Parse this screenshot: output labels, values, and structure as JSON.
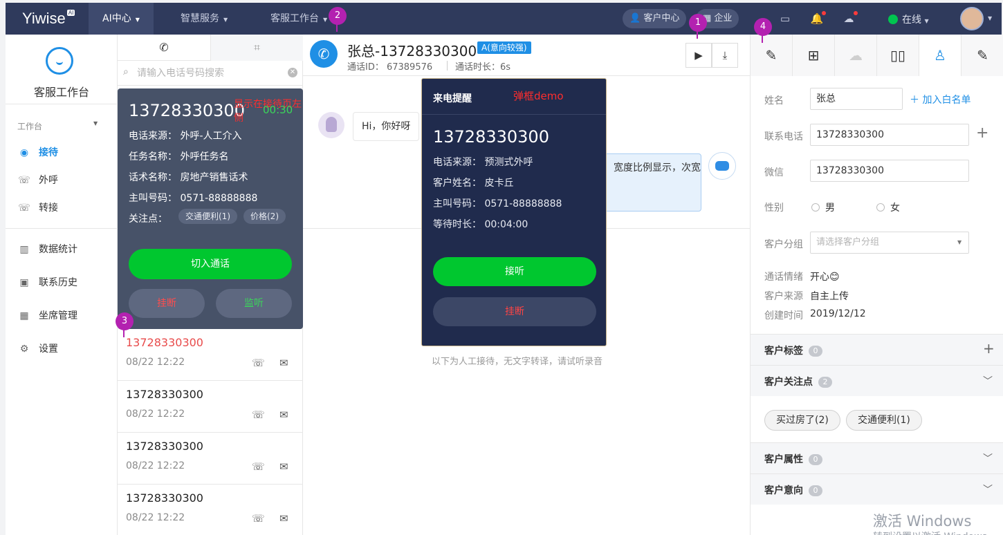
{
  "topbar": {
    "logo": "Yiwise",
    "logo_badge": "AI",
    "nav": [
      "AI中心",
      "智慧服务",
      "客服工作台"
    ],
    "customer_center": "客户中心",
    "enterprise": "企业",
    "status": "在线"
  },
  "sidebar": {
    "title": "客服工作台",
    "group_label": "工作台",
    "items": [
      {
        "label": "接待",
        "icon": "reception-icon"
      },
      {
        "label": "外呼",
        "icon": "outbound-call-icon"
      },
      {
        "label": "转接",
        "icon": "transfer-call-icon"
      },
      {
        "label": "数据统计",
        "icon": "bar-chart-icon"
      },
      {
        "label": "联系历史",
        "icon": "history-icon"
      },
      {
        "label": "坐席管理",
        "icon": "grid-icon"
      },
      {
        "label": "设置",
        "icon": "gear-icon"
      }
    ]
  },
  "list_panel": {
    "search_placeholder": "请输入电话号码搜索",
    "calls": [
      {
        "number": "13728330300",
        "time": "08/22  12:22",
        "missed": true
      },
      {
        "number": "13728330300",
        "time": "08/22  12:22",
        "missed": false
      },
      {
        "number": "13728330300",
        "time": "08/22  12:22",
        "missed": false
      },
      {
        "number": "13728330300",
        "time": "08/22  12:22",
        "missed": false
      }
    ]
  },
  "left_popup": {
    "number": "13728330300",
    "note": "显示在接待页左侧",
    "timer": "00:30",
    "source": "电话来源：  外呼-人工介入",
    "task": "任务名称：  外呼任务名",
    "script": "话术名称：  房地产销售话术",
    "caller": "主叫号码：  0571-88888888",
    "focus_label": "关注点：",
    "tags": [
      "交通便利(1)",
      "价格(2)"
    ],
    "join": "切入通话",
    "hangup": "挂断",
    "monitor": "监听"
  },
  "center": {
    "title": "张总-13728330300",
    "badge": "A(意向较强)",
    "call_id": "通话ID： 67389576",
    "duration": "通话时长：6s",
    "msg_user": "Hi，你好呀",
    "msg_bot": "宽度比例显示，次宽",
    "hint": "以下为人工接待，无文字转译，请试听录音"
  },
  "incoming": {
    "title": "来电提醒",
    "demo": "弹框demo",
    "number": "13728330300",
    "source": "电话来源：  预测式外呼",
    "name": "客户姓名：  皮卡丘",
    "caller": "主叫号码：  0571-88888888",
    "wait": "等待时长：  00:04:00",
    "accept": "接听",
    "hangup": "挂断"
  },
  "right": {
    "name_label": "姓名",
    "name_value": "张总",
    "whitelist": "加入白名单",
    "phone_label": "联系电话",
    "phone_value": "13728330300",
    "wechat_label": "微信",
    "wechat_value": "13728330300",
    "gender_label": "性别",
    "male": "男",
    "female": "女",
    "group_label": "客户分组",
    "group_placeholder": "请选择客户分组",
    "mood_label": "通话情绪",
    "mood_value": "开心😊",
    "src_label": "客户来源",
    "src_value": "自主上传",
    "created_label": "创建时间",
    "created_value": "2019/12/12",
    "sections": [
      {
        "title": "客户标签",
        "count": "0"
      },
      {
        "title": "客户关注点",
        "count": "2"
      },
      {
        "title": "客户属性",
        "count": "0"
      },
      {
        "title": "客户意向",
        "count": "0"
      }
    ],
    "chips": [
      "买过房了(2)",
      "交通便利(1)"
    ]
  },
  "markers": [
    "1",
    "2",
    "3",
    "4"
  ],
  "watermark": "激活 Windows",
  "watermark_sub": "转到设置以激活 Windows",
  "colors": {
    "nav": "#2f3a5c",
    "accent": "#1f8fe5",
    "green": "#00c72f",
    "red": "#e84b4b",
    "marker": "#b321b0"
  }
}
